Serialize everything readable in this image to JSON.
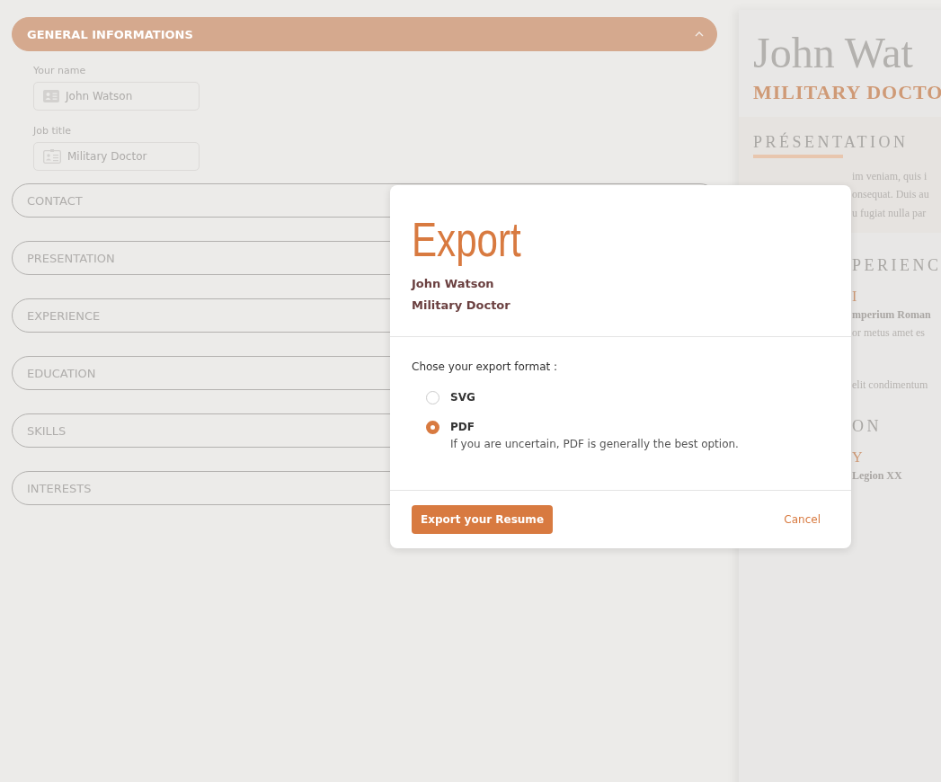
{
  "form": {
    "sections": [
      {
        "title": "GENERAL INFORMATIONS",
        "expanded": true,
        "fields": [
          {
            "label": "Your name",
            "value": "John Watson"
          },
          {
            "label": "Job title",
            "value": "Military Doctor"
          }
        ]
      },
      {
        "title": "CONTACT",
        "expanded": false
      },
      {
        "title": "PRESENTATION",
        "expanded": false
      },
      {
        "title": "EXPERIENCE",
        "expanded": false
      },
      {
        "title": "EDUCATION",
        "expanded": false
      },
      {
        "title": "SKILLS",
        "expanded": false
      },
      {
        "title": "INTERESTS",
        "expanded": false
      }
    ]
  },
  "preview": {
    "name": "John Wat",
    "job_title": "MILITARY DOCTO",
    "presentation": {
      "heading": "PRÉSENTATION",
      "lines": [
        "im veniam, quis i",
        "onsequat. Duis au",
        "u fugiat nulla par"
      ]
    },
    "experience": {
      "heading": "PERIENC",
      "entries": [
        {
          "kind": "accent",
          "text": "I"
        },
        {
          "kind": "bold",
          "text": "mperium Roman"
        },
        {
          "kind": "plain",
          "text": "or metus amet es"
        },
        {
          "kind": "plain",
          "text": "elit condimentum"
        }
      ]
    },
    "education": {
      "heading": "ON",
      "entries": [
        {
          "kind": "accent",
          "text": "Y"
        },
        {
          "kind": "bold",
          "text": "Legion XX"
        }
      ]
    }
  },
  "dialog": {
    "title": "Export",
    "name": "John Watson",
    "job_title": "Military Doctor",
    "prompt": "Chose your export format :",
    "options": [
      {
        "label": "SVG",
        "selected": false
      },
      {
        "label": "PDF",
        "selected": true,
        "hint": "If you are uncertain, PDF is generally the best option."
      }
    ],
    "primary_button": "Export your Resume",
    "cancel_button": "Cancel"
  }
}
